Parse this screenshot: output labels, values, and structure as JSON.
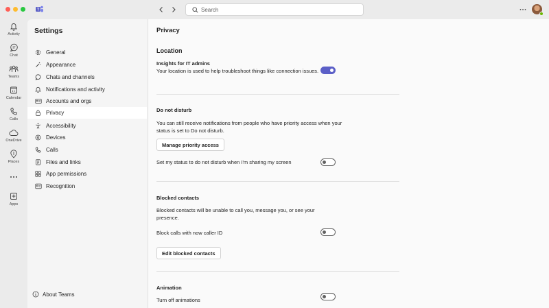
{
  "titlebar": {
    "search_placeholder": "Search"
  },
  "rail": {
    "items": [
      {
        "label": "Activity",
        "icon": "bell-icon"
      },
      {
        "label": "Chat",
        "icon": "chat-icon"
      },
      {
        "label": "Teams",
        "icon": "teams-icon"
      },
      {
        "label": "Calendar",
        "icon": "calendar-icon"
      },
      {
        "label": "Calls",
        "icon": "phone-icon"
      },
      {
        "label": "OneDrive",
        "icon": "cloud-icon"
      },
      {
        "label": "Places",
        "icon": "location-icon"
      },
      {
        "label": "Apps",
        "icon": "add-app-icon"
      }
    ]
  },
  "settings": {
    "title": "Settings",
    "items": [
      {
        "label": "General",
        "icon": "gear-icon"
      },
      {
        "label": "Appearance",
        "icon": "wand-icon"
      },
      {
        "label": "Chats and channels",
        "icon": "chat-bubble-icon"
      },
      {
        "label": "Notifications and activity",
        "icon": "bell-icon"
      },
      {
        "label": "Accounts and orgs",
        "icon": "id-card-icon"
      },
      {
        "label": "Privacy",
        "icon": "lock-icon",
        "active": true
      },
      {
        "label": "Accessibility",
        "icon": "accessibility-icon"
      },
      {
        "label": "Devices",
        "icon": "devices-icon"
      },
      {
        "label": "Calls",
        "icon": "phone-icon"
      },
      {
        "label": "Files and links",
        "icon": "link-icon"
      },
      {
        "label": "App permissions",
        "icon": "app-permissions-icon"
      },
      {
        "label": "Recognition",
        "icon": "recognition-icon"
      }
    ],
    "about": "About Teams"
  },
  "privacy": {
    "title": "Privacy",
    "location": {
      "heading": "Location",
      "insights_title": "Insights for IT admins",
      "insights_desc": "Your location is used to help troubleshoot things like connection issues.",
      "insights_on": true
    },
    "dnd": {
      "heading": "Do not disturb",
      "desc": "You can still receive notifications from people who have priority access when your status is set to Do not disturb.",
      "button": "Manage priority access",
      "sharing_label": "Set my status to do not disturb when I'm sharing my screen",
      "sharing_on": false
    },
    "blocked": {
      "heading": "Blocked contacts",
      "desc": "Blocked contacts will be unable to call you, message you, or see your presence.",
      "block_label": "Block calls with now caller ID",
      "block_on": false,
      "button": "Edit blocked contacts"
    },
    "animation": {
      "heading": "Animation",
      "label": "Turn off animations",
      "on": false
    }
  },
  "colors": {
    "accent": "#5b5fc7",
    "presence": "#6bb700"
  }
}
